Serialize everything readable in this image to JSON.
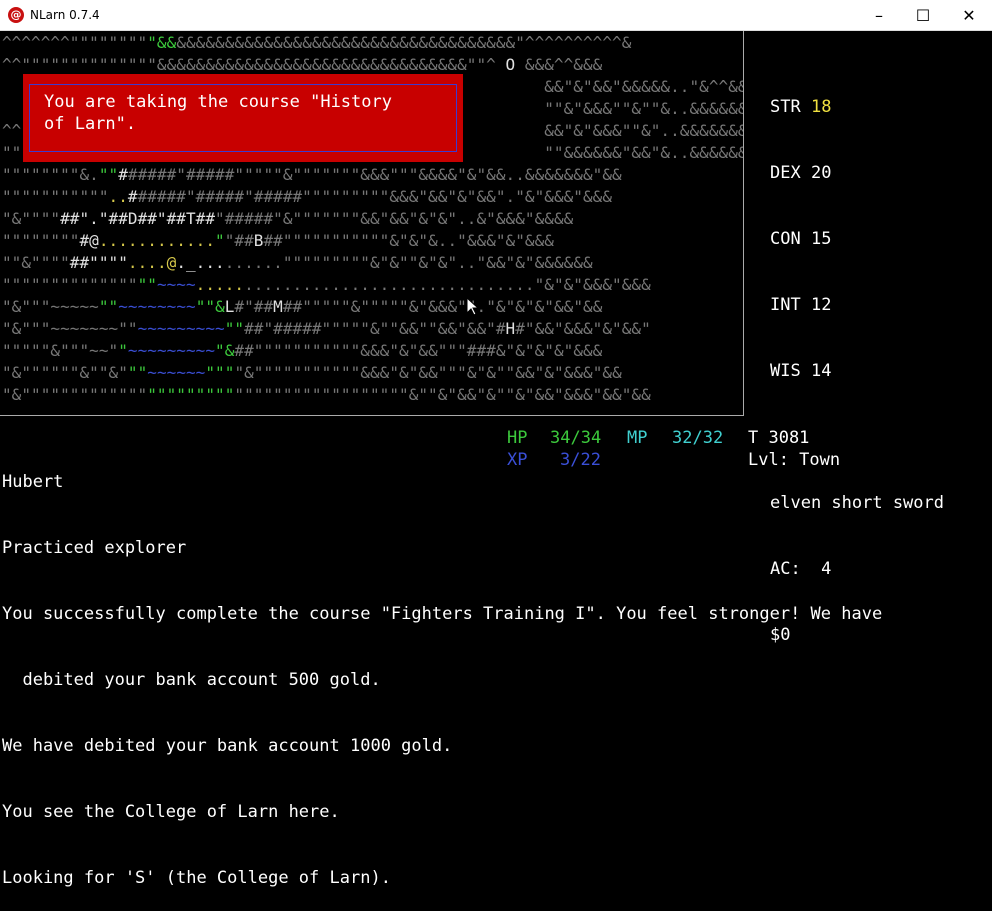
{
  "window": {
    "title": "NLarn 0.7.4",
    "icon_glyph": "@",
    "minimize": "–",
    "maximize": "☐",
    "close": "✕"
  },
  "map": {
    "lines": [
      [
        {
          "t": "^^^^^^^\"\"\"\"\"\"\"\"",
          "c": "c"
        },
        {
          "t": "\"&&",
          "c": "g"
        },
        {
          "t": "&&&&&&&&&&&&&&&&&&&&&&&&&&&&&&&&&&&\"^^^^^^^^^^&",
          "c": "c"
        }
      ],
      [
        {
          "t": "^^\"\"\"\"\"\"\"\"\"\"\"\"\"\"&&&&&&&&&&&&&&&&&&&&&&&&&&&&&&&&\"\"^ ",
          "c": "c"
        },
        {
          "t": "O",
          "c": "w"
        },
        {
          "t": " &&&^^&&&",
          "c": "c"
        }
      ],
      [
        {
          "t": "                                                        &&\"&\"&&\"&&&&&..\"&^^&&&",
          "c": "c"
        }
      ],
      [
        {
          "t": "                                                        \"\"&\"&&&\"\"&\"\"&..&&&&&&&&",
          "c": "c"
        }
      ],
      [
        {
          "t": "^^                                                      &&\"&\"&&&\"\"&\"..&&&&&&&&",
          "c": "c"
        }
      ],
      [
        {
          "t": "\"\"                                                      \"\"&&&&&&\"&&\"&..&&&&&&&&",
          "c": "c"
        }
      ],
      [
        {
          "t": "\"\"\"\"\"\"\"\"&.",
          "c": "c"
        },
        {
          "t": "\"\"",
          "c": "g"
        },
        {
          "t": "#",
          "c": "w"
        },
        {
          "t": "#####\"#####\"\"\"\"\"&\"\"\"\"\"\"\"&&&\"\"\"&&&&\"&\"&&..&&&&&&&\"&&",
          "c": "c"
        }
      ],
      [
        {
          "t": "\"\"\"\"\"\"\"\"\"\"\"",
          "c": "c"
        },
        {
          "t": "..",
          "c": "y"
        },
        {
          "t": "#",
          "c": "w"
        },
        {
          "t": "#####\"#####\"#####\"\"\"\"\"\"\"\"\"&&&\"&&\"&\"&&\".\"&\"&&&\"&&&",
          "c": "c"
        }
      ],
      [
        {
          "t": "\"&\"\"\"\"",
          "c": "c"
        },
        {
          "t": "##\".\"##D##\"##T##",
          "c": "w"
        },
        {
          "t": "\"#####\"&\"\"\"\"\"\"\"&&\"&&\"&\"&\"..&\"&&&\"&&&&",
          "c": "c"
        }
      ],
      [
        {
          "t": "\"\"\"\"\"\"\"\"",
          "c": "c"
        },
        {
          "t": "#@",
          "c": "w"
        },
        {
          "t": "............",
          "c": "y"
        },
        {
          "t": "\"",
          "c": "g"
        },
        {
          "t": "\"##",
          "c": "c"
        },
        {
          "t": "B",
          "c": "w"
        },
        {
          "t": "##\"\"\"\"\"\"\"\"\"\"\"&\"&\"&..\"&&&\"&\"&&&",
          "c": "c"
        }
      ],
      [
        {
          "t": "\"\"&\"\"\"\"",
          "c": "c"
        },
        {
          "t": "##\"\"\"\"",
          "c": "w"
        },
        {
          "t": "....",
          "c": "y"
        },
        {
          "t": "@",
          "c": "y"
        },
        {
          "t": "._...",
          "c": "w"
        },
        {
          "t": "......\"\"\"\"\"\"\"\"\"&\"&\"\"&\"&\"..\"&&\"&\"&&&&&&",
          "c": "c"
        }
      ],
      [
        {
          "t": "\"\"\"\"\"\"\"\"\"\"\"\"\"\"",
          "c": "c"
        },
        {
          "t": "\"\"",
          "c": "g"
        },
        {
          "t": "~~~~",
          "c": "b"
        },
        {
          "t": ".....",
          "c": "y"
        },
        {
          "t": "..............................\"&\"&\"&&&\"&&&",
          "c": "c"
        }
      ],
      [
        {
          "t": "\"&\"\"\"",
          "c": "c"
        },
        {
          "t": "~~~~~",
          "c": "c"
        },
        {
          "t": "\"\"",
          "c": "g"
        },
        {
          "t": "~~~~~~~~",
          "c": "b"
        },
        {
          "t": "\"\"",
          "c": "g"
        },
        {
          "t": "&",
          "c": "g"
        },
        {
          "t": "L",
          "c": "w"
        },
        {
          "t": "#\"##",
          "c": "c"
        },
        {
          "t": "M",
          "c": "w"
        },
        {
          "t": "##\"\"\"\"\"&\"\"\"\"\"&\"&&&\"\".\"&\"&\"&\"&&\"&&",
          "c": "c"
        }
      ],
      [
        {
          "t": "\"&\"\"\"~~~~~~~\"\"",
          "c": "c"
        },
        {
          "t": "~~~~~~~~~",
          "c": "b"
        },
        {
          "t": "\"\"",
          "c": "g"
        },
        {
          "t": "##\"#####\"\"\"\"\"&\"\"&&\"\"&&\"&&\"#",
          "c": "c"
        },
        {
          "t": "H",
          "c": "w"
        },
        {
          "t": "#\"&&\"&&&\"&\"&&\"",
          "c": "c"
        }
      ],
      [
        {
          "t": "\"\"\"\"\"&\"\"\"~~\"",
          "c": "c"
        },
        {
          "t": "\"",
          "c": "g"
        },
        {
          "t": "~~~~~~~~~",
          "c": "b"
        },
        {
          "t": "\"",
          "c": "g"
        },
        {
          "t": "&",
          "c": "g"
        },
        {
          "t": "##\"\"\"\"\"\"\"\"\"\"\"&&&\"&\"&&\"\"\"###&\"&\"&\"&\"&&&",
          "c": "c"
        }
      ],
      [
        {
          "t": "\"&\"\"\"\"\"\"&\"\"&\"",
          "c": "c"
        },
        {
          "t": "\"\"",
          "c": "g"
        },
        {
          "t": "~~~~~~",
          "c": "b"
        },
        {
          "t": "\"\"\"",
          "c": "g"
        },
        {
          "t": "\"&\"\"\"\"\"\"\"\"\"\"\"&&&\"&\"&&\"\"\"&\"&\"\"&&\"&\"&&&\"&&",
          "c": "c"
        }
      ],
      [
        {
          "t": "\"&\"\"\"\"\"\"\"\"\"\"\"\"\"",
          "c": "c"
        },
        {
          "t": "\"\"\"\"\"\"\"\"\"",
          "c": "g"
        },
        {
          "t": "\"\"\"\"\"\"\"\"\"\"\"\"\"\"\"\"\"\"&\"\"&\"&&\"&\"\"&\"&&\"&&&\"&&\"&&",
          "c": "c"
        }
      ]
    ]
  },
  "popup": {
    "message": "You are taking the course \"History\nof Larn\"."
  },
  "stats": {
    "lines": [
      {
        "label": "STR",
        "value": "18"
      },
      {
        "label": "DEX",
        "value": "20"
      },
      {
        "label": "CON",
        "value": "15"
      },
      {
        "label": "INT",
        "value": "12"
      },
      {
        "label": "WIS",
        "value": "14"
      }
    ],
    "weapon": "elven short sword",
    "ac": "AC:  4",
    "gold": "$0"
  },
  "status": {
    "name": "Hubert",
    "rank": "Practiced explorer",
    "hp_label": "HP",
    "hp_value": "34/34",
    "mp_label": "MP",
    "mp_value": "32/32",
    "turn": "T 3081",
    "xp_label": "XP",
    "xp_value": "3/22",
    "level": "Lvl: Town",
    "colors": {
      "hp": "#3cc83c",
      "mp": "#40d0d0",
      "xp": "#3a4fd6"
    }
  },
  "log": [
    "You successfully complete the course \"Fighters Training I\". You feel stronger! We have",
    "  debited your bank account 500 gold.",
    "We have debited your bank account 1000 gold.",
    "You see the College of Larn here.",
    "Looking for 'S' (the College of Larn)."
  ]
}
